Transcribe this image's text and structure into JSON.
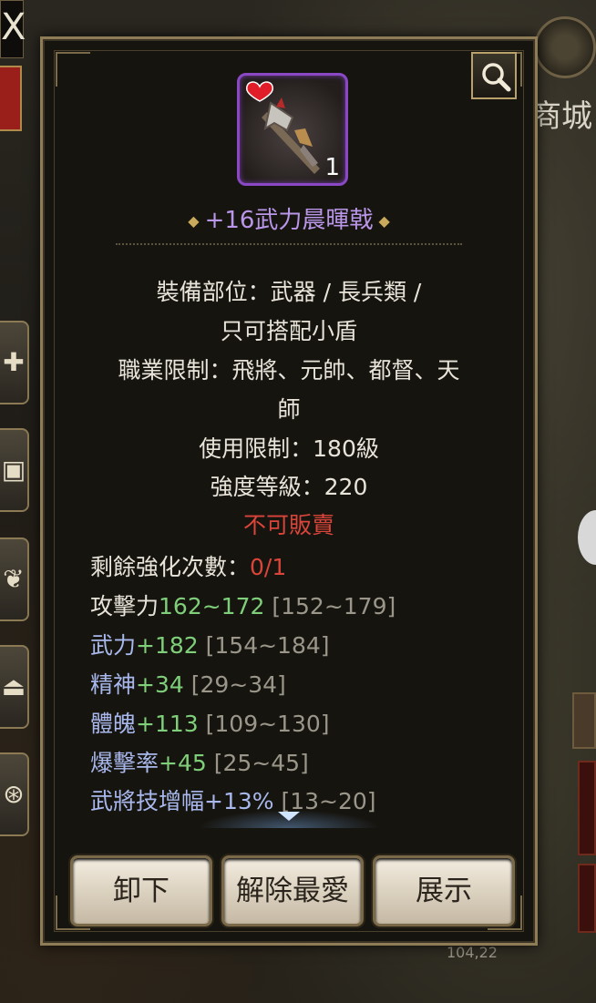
{
  "background": {
    "close_glyph": "X",
    "shop_label": "商城",
    "bottom_number": "104,22",
    "side_icons": [
      "plus-icon",
      "bag-icon",
      "laurel-icon",
      "eject-icon",
      "wheel-icon"
    ]
  },
  "item": {
    "quantity": "1",
    "name": "+16武力晨暉戟",
    "favorite_icon": "heart-icon",
    "weapon_icon": "halberd-icon",
    "rarity_color": "#8a48c5"
  },
  "details": {
    "equip_slot": "裝備部位：武器 / 長兵類 /",
    "equip_slot_2": "只可搭配小盾",
    "class_limit": "職業限制：飛將、元帥、都督、天",
    "class_limit_2": "師",
    "level_limit": "使用限制：180級",
    "strength_level": "強度等級：220",
    "not_sellable": "不可販賣"
  },
  "stats": {
    "enhance_label": "剩餘強化次數：",
    "enhance_value": "0/1",
    "attack_label": "攻擊力",
    "attack_value": "162~172",
    "attack_range": "[152~179]",
    "might_label": "武力",
    "might_value": "+182",
    "might_range": "[154~184]",
    "spirit_label": "精神",
    "spirit_value": "+34",
    "spirit_range": "[29~34]",
    "body_label": "體魄",
    "body_value": "+113",
    "body_range": "[109~130]",
    "crit_label": "爆擊率",
    "crit_value": "+45",
    "crit_range": "[25~45]",
    "skill_label": "武將技增幅",
    "skill_value": "+13%",
    "skill_range": "[13~20]"
  },
  "buttons": {
    "unequip": "卸下",
    "unfavorite": "解除最愛",
    "show": "展示"
  },
  "colors": {
    "item_name": "#b996e8",
    "bonus_green": "#7fcf7a",
    "warning_red": "#d9453a"
  }
}
